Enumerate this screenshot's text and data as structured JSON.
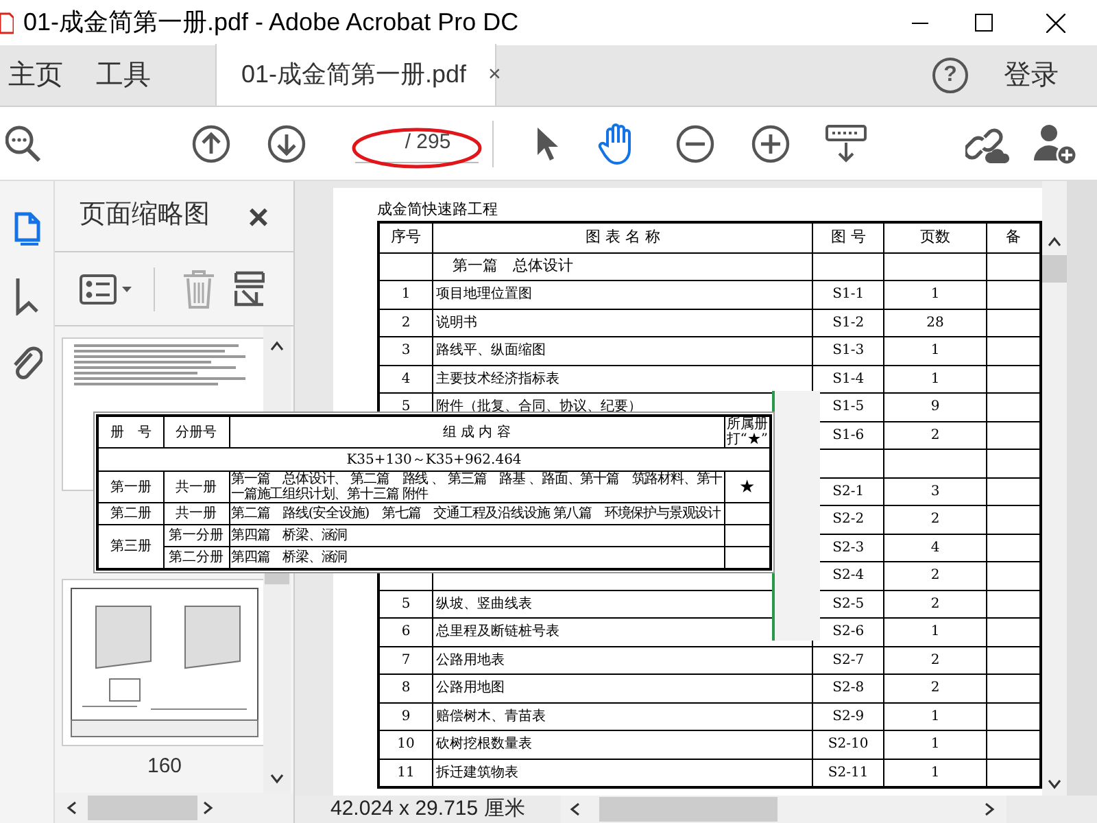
{
  "window": {
    "title": "01-成金简第一册.pdf - Adobe Acrobat Pro DC"
  },
  "tabs": [
    {
      "label": "主页",
      "selected": false
    },
    {
      "label": "工具",
      "selected": false
    },
    {
      "label": "01-成金简第一册.pdf",
      "selected": true,
      "close": "×"
    }
  ],
  "help": {
    "label": "?"
  },
  "account": {
    "label": "登录"
  },
  "toolbar": {
    "page_total": "/ 295",
    "tools": [
      {
        "kind": "select",
        "selected": false
      },
      {
        "kind": "hand",
        "selected": true
      }
    ]
  },
  "sidebar": {
    "items": [
      {
        "kind": "pages",
        "selected": true
      },
      {
        "kind": "bookmarks",
        "selected": false
      },
      {
        "kind": "attachments",
        "selected": false
      }
    ]
  },
  "thumbnails": {
    "title": "页面缩略图",
    "close": "×",
    "page_label": "160"
  },
  "document": {
    "heading": "成金简快速路工程",
    "columns": [
      "序号",
      "图 表 名 称",
      "图 号",
      "页数",
      "备"
    ],
    "rows": [
      {
        "kind": "section",
        "name": "第一篇　总体设计"
      },
      {
        "kind": "item",
        "no": "1",
        "name": "项目地理位置图",
        "code": "S1-1",
        "pages": "1"
      },
      {
        "kind": "item",
        "no": "2",
        "name": "说明书",
        "code": "S1-2",
        "pages": "28"
      },
      {
        "kind": "item",
        "no": "3",
        "name": "路线平、纵面缩图",
        "code": "S1-3",
        "pages": "1"
      },
      {
        "kind": "item",
        "no": "4",
        "name": "主要技术经济指标表",
        "code": "S1-4",
        "pages": "1"
      },
      {
        "kind": "item",
        "no": "5",
        "name": "附件（批复、合同、协议、纪要）",
        "code": "S1-5",
        "pages": "9"
      },
      {
        "kind": "item",
        "code": "S1-6",
        "pages": "2"
      },
      {
        "kind": "section"
      },
      {
        "kind": "item",
        "code": "S2-1",
        "pages": "3"
      },
      {
        "kind": "item",
        "code": "S2-2",
        "pages": "2"
      },
      {
        "kind": "item",
        "code": "S2-3",
        "pages": "4"
      },
      {
        "kind": "item",
        "code": "S2-4",
        "pages": "2"
      },
      {
        "kind": "item",
        "no": "5",
        "name": "纵坡、竖曲线表",
        "code": "S2-5",
        "pages": "2"
      },
      {
        "kind": "item",
        "no": "6",
        "name": "总里程及断链桩号表",
        "code": "S2-6",
        "pages": "1"
      },
      {
        "kind": "item",
        "no": "7",
        "name": "公路用地表",
        "code": "S2-7",
        "pages": "2"
      },
      {
        "kind": "item",
        "no": "8",
        "name": "公路用地图",
        "code": "S2-8",
        "pages": "2"
      },
      {
        "kind": "item",
        "no": "9",
        "name": "赔偿树木、青苗表",
        "code": "S2-9",
        "pages": "1"
      },
      {
        "kind": "item",
        "no": "10",
        "name": "砍树挖根数量表",
        "code": "S2-10",
        "pages": "1"
      },
      {
        "kind": "item",
        "no": "11",
        "name": "拆迁建筑物表",
        "code": "S2-11",
        "pages": "1"
      }
    ]
  },
  "overlay_table": {
    "columns": [
      "册　号",
      "分册号",
      "组 成 内 容",
      "所属册打“★”"
    ],
    "range": "K35+130～K35+962.464",
    "volumes": [
      {
        "volume": "第一册",
        "parts": [
          {
            "part": "共一册",
            "content": "第一篇　总体设计、 第二篇　路线 、 第三篇　路基 、路面、第十篇　筑路材料、第十一篇施工组织计划、第十三篇 附件",
            "mark": "★"
          }
        ]
      },
      {
        "volume": "第二册",
        "parts": [
          {
            "part": "共一册",
            "content": "第二篇　路线(安全设施)　第七篇　交通工程及沿线设施 第八篇　环境保护与景观设计"
          }
        ]
      },
      {
        "volume": "第三册",
        "parts": [
          {
            "part": "第一分册",
            "content": "第四篇　桥梁、涵洞"
          },
          {
            "part": "第二分册",
            "content": "第四篇　桥梁、涵洞"
          }
        ]
      }
    ]
  },
  "status_bar": {
    "page_size": "42.024 x 29.715 厘米"
  }
}
